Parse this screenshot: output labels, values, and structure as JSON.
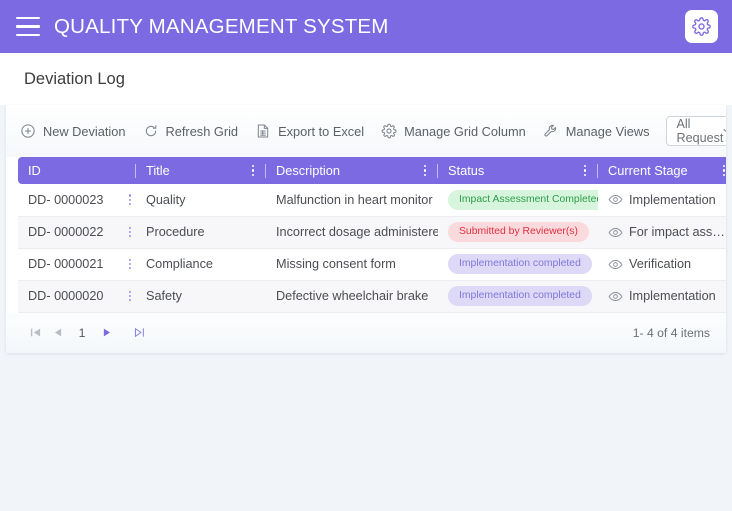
{
  "header": {
    "title": "QUALITY MANAGEMENT SYSTEM",
    "menu_icon": "hamburger-icon",
    "settings_icon": "gear-icon",
    "bg_color": "#7b6ae2"
  },
  "page": {
    "title": "Deviation Log"
  },
  "toolbar": {
    "actions": [
      {
        "label": "New Deviation",
        "icon": "plus-circle-icon"
      },
      {
        "label": "Refresh Grid",
        "icon": "refresh-icon"
      },
      {
        "label": "Export to Excel",
        "icon": "spreadsheet-icon"
      },
      {
        "label": "Manage Grid Column",
        "icon": "gear-icon"
      },
      {
        "label": "Manage Views",
        "icon": "wrench-icon"
      }
    ],
    "filter": {
      "selected": "All Request",
      "placeholder": "All Request",
      "chevron_icon": "chevron-down-icon"
    }
  },
  "grid": {
    "columns": [
      {
        "key": "id",
        "label": "ID",
        "kebab": false
      },
      {
        "key": "title",
        "label": "Title",
        "kebab": true
      },
      {
        "key": "desc",
        "label": "Description",
        "kebab": true
      },
      {
        "key": "status",
        "label": "Status",
        "kebab": true
      },
      {
        "key": "stage",
        "label": "Current Stage",
        "kebab": true
      }
    ],
    "rows": [
      {
        "id": "DD- 0000023",
        "title": "Quality",
        "desc": "Malfunction in heart monitor",
        "status": "Impact Assessment Completed",
        "status_tone": "green",
        "stage": "Implementation",
        "stage_icon": "eye-icon"
      },
      {
        "id": "DD- 0000022",
        "title": "Procedure",
        "desc": "Incorrect dosage administered",
        "status": "Submitted by Reviewer(s)",
        "status_tone": "red",
        "stage": "For impact assessment",
        "stage_icon": "eye-icon"
      },
      {
        "id": "DD- 0000021",
        "title": "Compliance",
        "desc": "Missing consent form",
        "status": "Implementation completed",
        "status_tone": "purple",
        "stage": "Verification",
        "stage_icon": "eye-icon"
      },
      {
        "id": "DD- 0000020",
        "title": "Safety",
        "desc": "Defective wheelchair brake",
        "status": "Implementation completed",
        "status_tone": "purple",
        "stage": "Implementation",
        "stage_icon": "eye-icon"
      }
    ],
    "row_kebab_icon": "kebab-menu-icon"
  },
  "pager": {
    "first_icon": "first-page-icon",
    "prev_icon": "previous-page-icon",
    "next_icon": "next-page-icon",
    "last_icon": "last-page-icon",
    "current_page": "1",
    "info": "1- 4 of 4 items",
    "active_color": "#7b6ae2",
    "disabled_color": "#b9bec6"
  },
  "colors": {
    "accent": "#7b6ae2",
    "page_bg": "#f1f5f9",
    "badge_green_bg": "#d6f5dc",
    "badge_green_fg": "#2e9e4a",
    "badge_red_bg": "#fadadd",
    "badge_red_fg": "#e03040",
    "badge_purple_bg": "#ddd9f7",
    "badge_purple_fg": "#8278d8"
  }
}
